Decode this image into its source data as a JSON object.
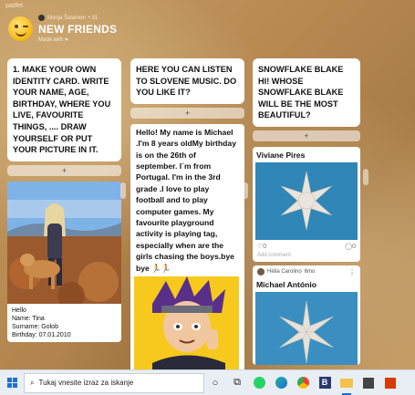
{
  "app": {
    "brand": "padlet"
  },
  "board": {
    "author": "Monja Šalamon",
    "author_time": "• 31",
    "title": "NEW FRIENDS",
    "subtitle": "Made with ♥"
  },
  "columns": [
    {
      "heading": "1. MAKE YOUR OWN IDENTITY CARD. WRITE YOUR NAME, AGE, BIRTHDAY, WHERE YOU LIVE, FAVOURITE THINGS, .... DRAW YOURSELF OR PUT YOUR PICTURE IN IT.",
      "add_label": "+",
      "post": {
        "lines": [
          "Hello",
          "Name: Tina",
          "Surname: Golob",
          "Birthday: 07.01.2010"
        ]
      }
    },
    {
      "heading": "HERE YOU CAN LISTEN TO SLOVENE MUSIC. DO YOU LIKE IT?",
      "add_label": "+",
      "post": {
        "text": "Hello! My name is Michael .I'm 8 years oldMy birthday is on the 26th of september. I´m from Portugal. I'm in the 3rd grade .I love to play football and to play computer games. My favourite playground activity is playing tag, especially when are the girls chasing the boys.bye bye 🏃🏃"
      }
    },
    {
      "heading": "SNOWFLAKE BLAKE HI! WHOSE SNOWFLAKE BLAKE WILL BE THE MOST BEAUTIFUL?",
      "add_label": "+",
      "posts": [
        {
          "title": "Viviane Pires",
          "likes": "0",
          "comments": "0",
          "add_comment": "Add comment"
        },
        {
          "author": "Hélia Carolino",
          "time": "6mo",
          "title": "Michael António"
        }
      ]
    }
  ],
  "taskbar": {
    "search_placeholder": "Tukaj vnesite izraz za iskanje",
    "icons": [
      "start-icon",
      "cortana-icon",
      "task-view-icon",
      "whatsapp-icon",
      "edge-icon",
      "chrome-icon",
      "b-app-icon",
      "file-explorer-icon",
      "store-icon",
      "office-icon"
    ]
  },
  "colors": {
    "wallpaper": "#b98f57",
    "accent": "#1f6fd1"
  }
}
